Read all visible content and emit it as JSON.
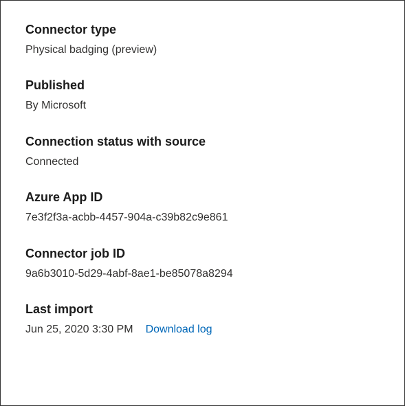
{
  "connector_type": {
    "label": "Connector type",
    "value": "Physical badging (preview)"
  },
  "published": {
    "label": "Published",
    "value": "By Microsoft"
  },
  "connection_status": {
    "label": "Connection status with source",
    "value": "Connected"
  },
  "azure_app_id": {
    "label": "Azure App ID",
    "value": "7e3f2f3a-acbb-4457-904a-c39b82c9e861"
  },
  "connector_job_id": {
    "label": "Connector job ID",
    "value": "9a6b3010-5d29-4abf-8ae1-be85078a8294"
  },
  "last_import": {
    "label": "Last import",
    "timestamp": "Jun 25, 2020 3:30 PM",
    "download_log_label": "Download log"
  }
}
